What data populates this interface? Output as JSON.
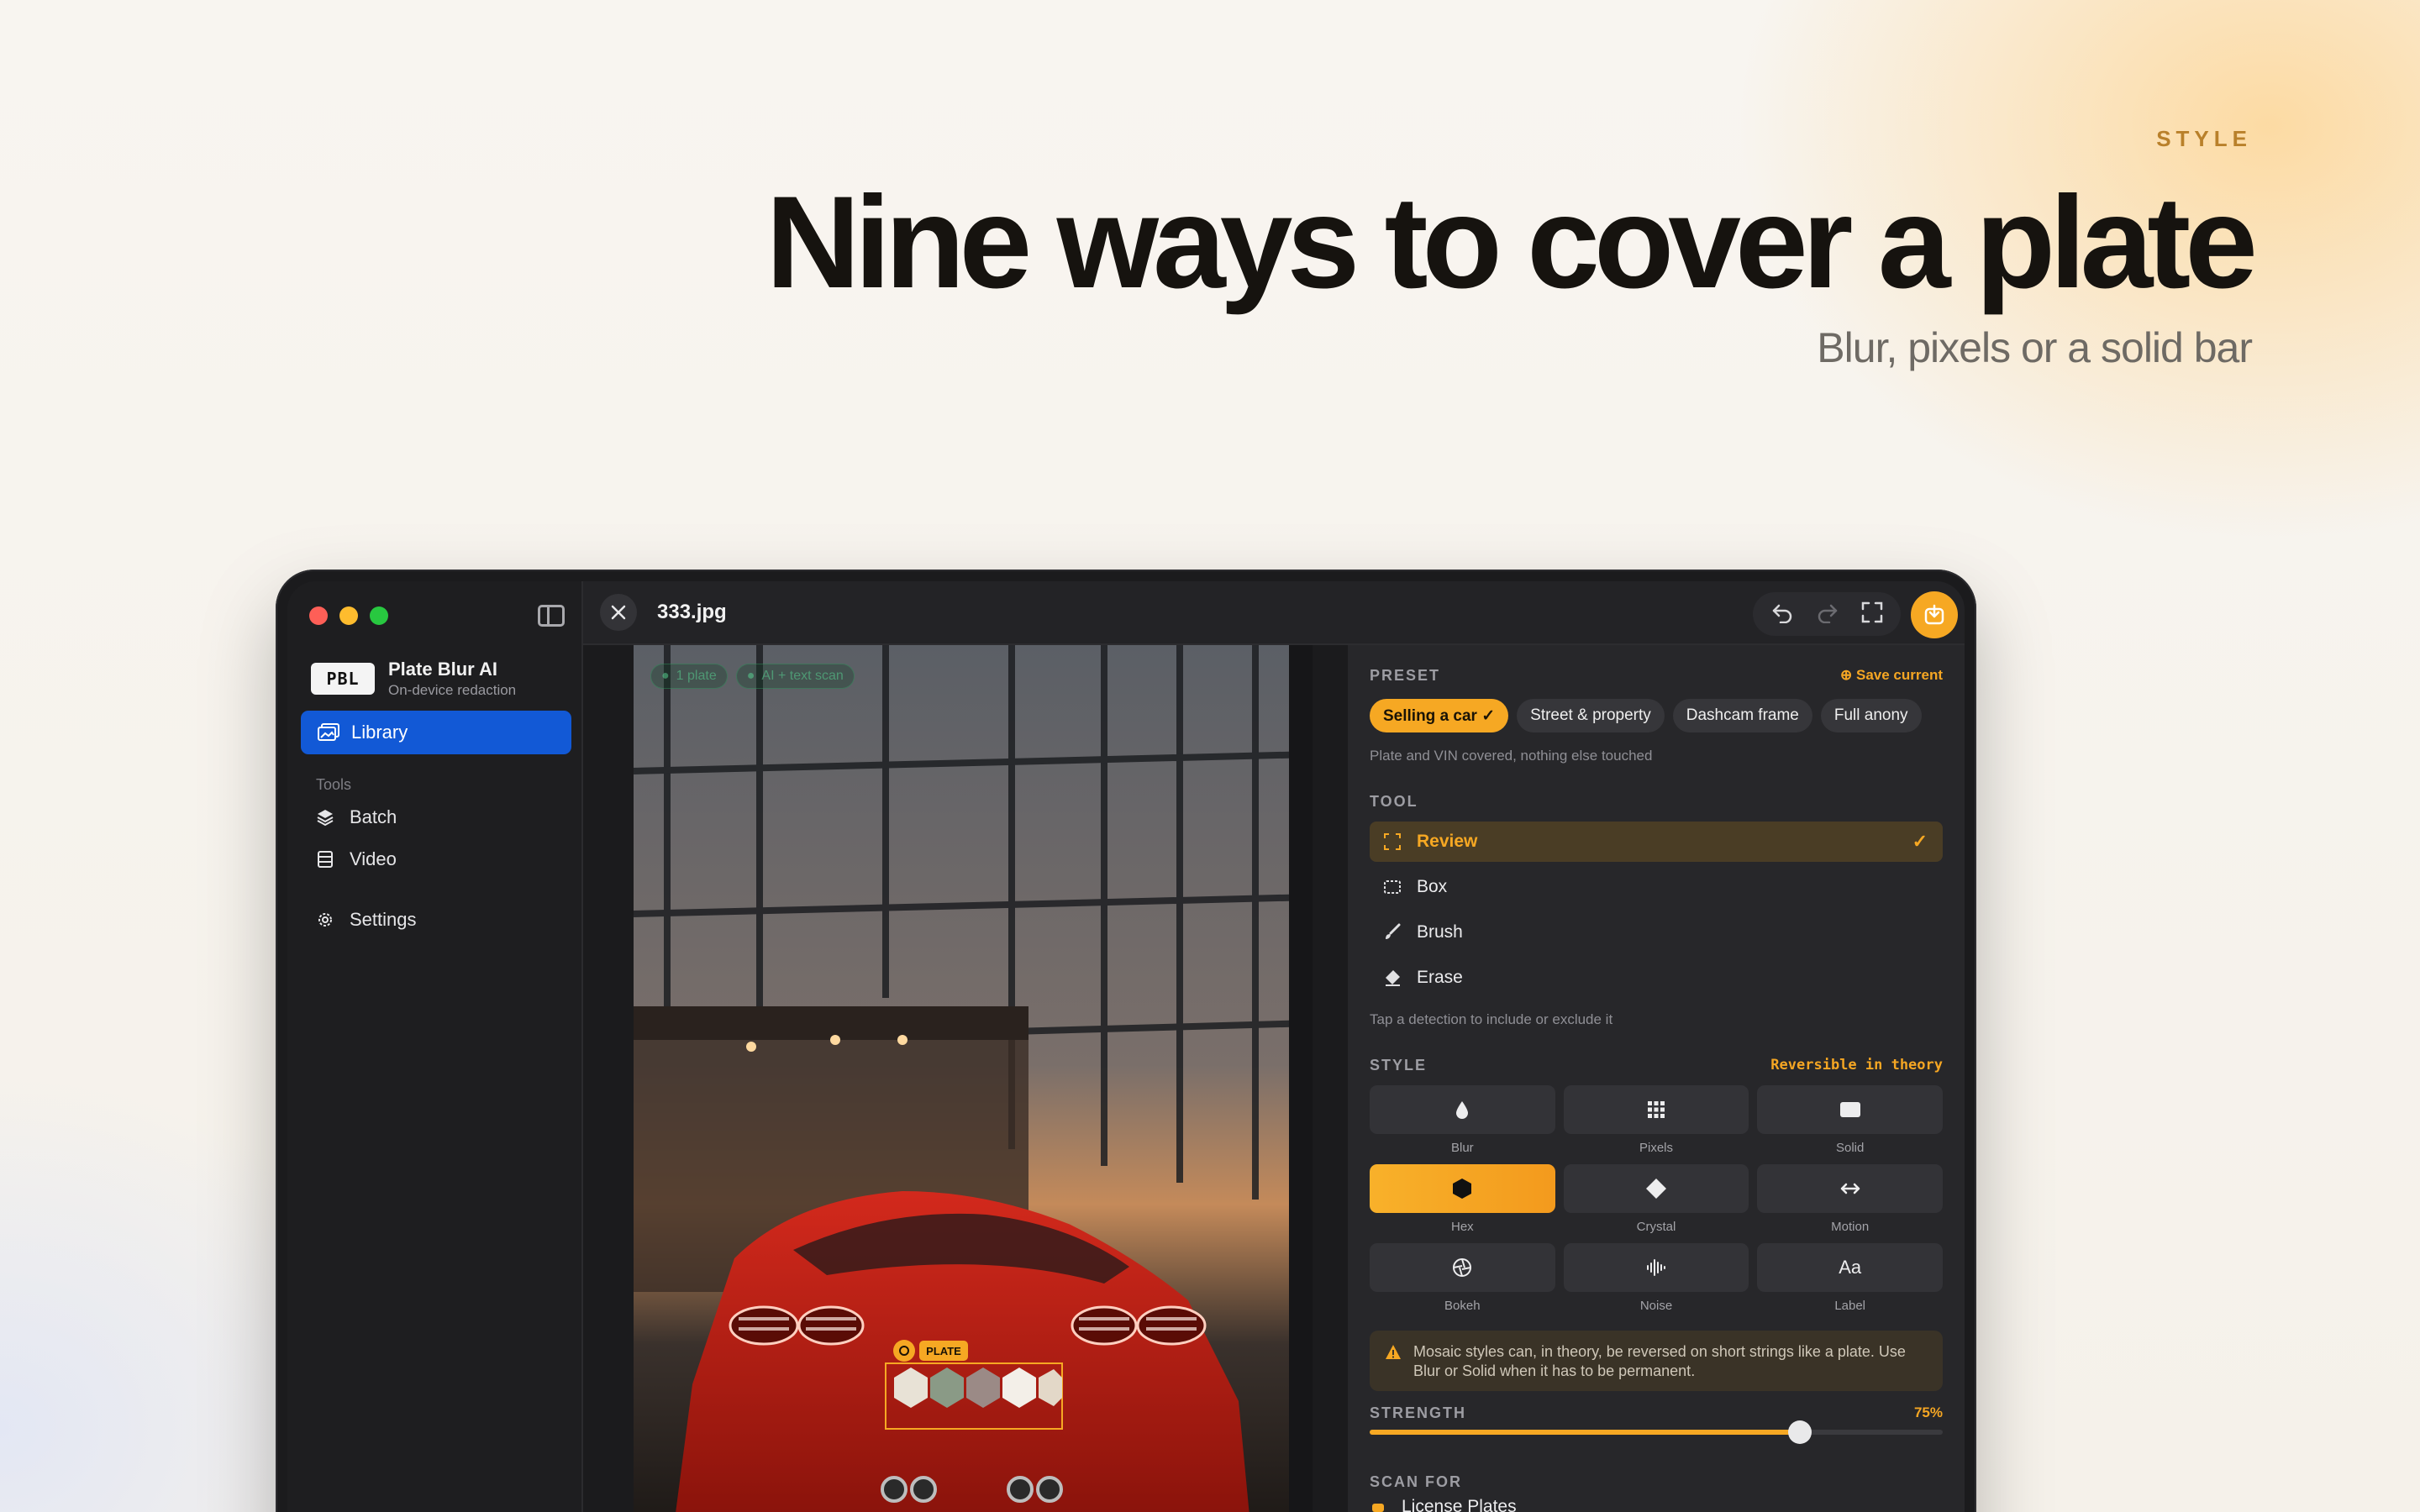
{
  "hero": {
    "eyebrow": "STYLE",
    "headline": "Nine ways to cover a plate",
    "subhead": "Blur, pixels or a solid bar"
  },
  "app": {
    "name": "Plate Blur AI",
    "tagline": "On-device redaction",
    "logo_text": "PBL",
    "file_name": "333.jpg"
  },
  "sidebar": {
    "library": "Library",
    "tools_label": "Tools",
    "batch": "Batch",
    "video": "Video",
    "settings": "Settings"
  },
  "photo": {
    "badge_plate": "1 plate",
    "badge_ai": "AI + text scan",
    "plate_tag": "PLATE"
  },
  "panel": {
    "preset_label": "PRESET",
    "save_current": "Save current",
    "presets": [
      "Selling a car ✓",
      "Street & property",
      "Dashcam frame",
      "Full anony"
    ],
    "preset_hint": "Plate and VIN covered, nothing else touched",
    "tool_label": "TOOL",
    "tools": [
      "Review",
      "Box",
      "Brush",
      "Erase"
    ],
    "tool_hint": "Tap a detection to include or exclude it",
    "style_label": "STYLE",
    "style_note": "Reversible in theory",
    "styles": [
      "Blur",
      "Pixels",
      "Solid",
      "Hex",
      "Crystal",
      "Motion",
      "Bokeh",
      "Noise",
      "Label"
    ],
    "style_selected": "Hex",
    "warning": "Mosaic styles can, in theory, be reversed on short strings like a plate. Use Blur or Solid when it has to be permanent.",
    "strength_label": "STRENGTH",
    "strength_value": "75%",
    "strength": 0.75,
    "scan_label": "SCAN FOR",
    "scan_item": "License Plates"
  },
  "colors": {
    "accent": "#f6a823",
    "selection_blue": "#1259d6",
    "window_bg": "#232326"
  }
}
